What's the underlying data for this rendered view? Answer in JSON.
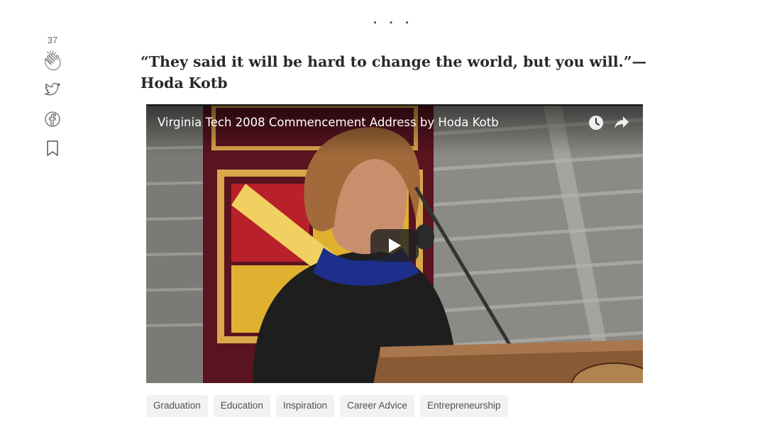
{
  "section_divider": "...",
  "sidebar": {
    "clap_count": "37",
    "icons": [
      "clap-icon",
      "twitter-icon",
      "facebook-icon",
      "bookmark-icon"
    ]
  },
  "quote": "“They said it will be hard to change the world, but you will.”—Hoda Kotb",
  "video": {
    "title": "Virginia Tech 2008 Commencement Address by Hoda Kotb",
    "icons": [
      "watch-later-icon",
      "share-icon",
      "play-icon"
    ]
  },
  "tags": [
    "Graduation",
    "Education",
    "Inspiration",
    "Career Advice",
    "Entrepreneurship"
  ],
  "colors": {
    "text": "#292929",
    "tag_bg": "#f2f2f2",
    "play_button": "#212121"
  }
}
